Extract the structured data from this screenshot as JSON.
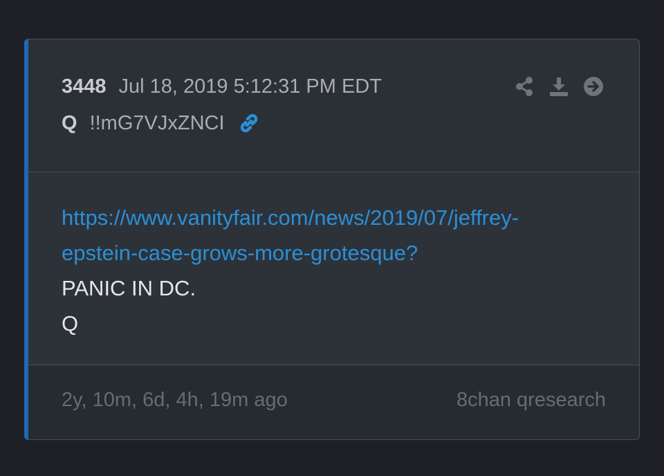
{
  "post": {
    "number": "3448",
    "date": "Jul 18, 2019 5:12:31 PM EDT",
    "author": "Q",
    "tripcode": "!!mG7VJxZNCI",
    "link_line1": "https://www.vanityfair.com/news/2019/07/jeffrey-",
    "link_line2": "epstein-case-grows-more-grotesque?",
    "text_line1": "PANIC IN DC.",
    "text_line2": "Q"
  },
  "footer": {
    "ago": "2y, 10m, 6d, 4h, 19m ago",
    "source": "8chan qresearch"
  },
  "icons": {
    "link": "link-icon",
    "share": "share-icon",
    "download": "download-icon",
    "open": "arrow-right-circle-icon"
  },
  "colors": {
    "accent": "#1c6ab5",
    "link": "#2b8fd6",
    "background": "#1f2027",
    "card": "#2a2e35"
  }
}
